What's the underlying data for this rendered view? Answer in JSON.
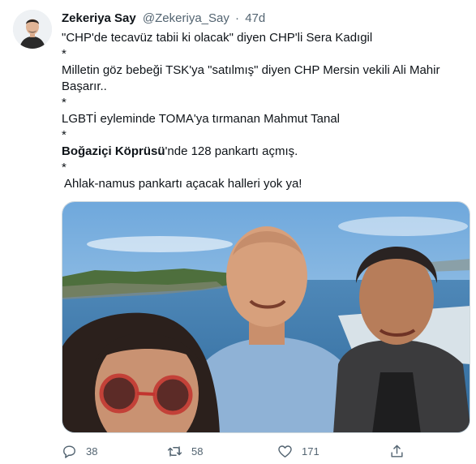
{
  "author": {
    "name": "Zekeriya Say",
    "handle": "@Zekeriya_Say",
    "separator": "·",
    "time": "47d"
  },
  "tweet": {
    "line1": "\"CHP'de tecavüz tabii ki olacak\" diyen CHP'li Sera Kadıgil",
    "star": "*",
    "line2": "Milletin göz bebeği TSK'ya \"satılmış\" diyen CHP Mersin vekili Ali Mahir Başarır..",
    "line3": "LGBTİ eyleminde TOMA'ya tırmanan Mahmut Tanal",
    "line4_bold": "Boğaziçi Köprüsü",
    "line4_rest": "'nde 128 pankartı açmış.",
    "line5": "Ahlak-namus pankartı açacak halleri yok ya!"
  },
  "actions": {
    "replies": "38",
    "retweets": "58",
    "likes": "171"
  },
  "icons": {
    "reply": "reply-icon",
    "retweet": "retweet-icon",
    "like": "heart-icon",
    "share": "share-icon"
  },
  "colors": {
    "text": "#0f1419",
    "secondary": "#536471",
    "border": "#cfd9de"
  }
}
